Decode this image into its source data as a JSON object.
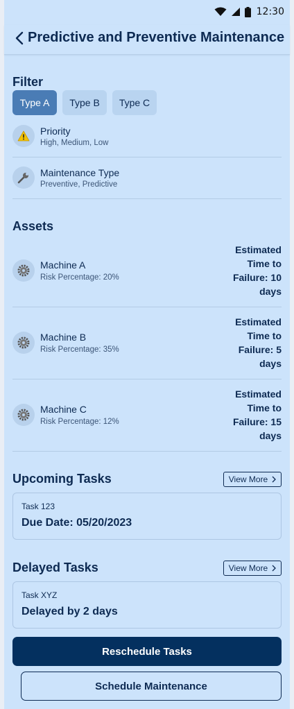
{
  "status_bar": {
    "time": "12:30",
    "icons": [
      "wifi-icon",
      "signal-icon",
      "battery-icon"
    ]
  },
  "header": {
    "title": "Predictive and Preventive Maintenance"
  },
  "filter": {
    "heading": "Filter",
    "chips": [
      {
        "label": "Type A",
        "selected": true
      },
      {
        "label": "Type B",
        "selected": false
      },
      {
        "label": "Type C",
        "selected": false
      }
    ],
    "items": [
      {
        "title": "Priority",
        "subtitle": "High, Medium, Low",
        "icon": "warning-icon"
      },
      {
        "title": "Maintenance Type",
        "subtitle": "Preventive, Predictive",
        "icon": "wrench-icon"
      }
    ]
  },
  "assets": {
    "heading": "Assets",
    "items": [
      {
        "name": "Machine A",
        "risk": "Risk Percentage: 20%",
        "estimate": [
          "Estimated",
          "Time to",
          "Failure: 10",
          "days"
        ]
      },
      {
        "name": "Machine B",
        "risk": "Risk Percentage: 35%",
        "estimate": [
          "Estimated",
          "Time to",
          "Failure: 5",
          "days"
        ]
      },
      {
        "name": "Machine C",
        "risk": "Risk Percentage: 12%",
        "estimate": [
          "Estimated",
          "Time to",
          "Failure: 15",
          "days"
        ]
      }
    ]
  },
  "upcoming": {
    "heading": "Upcoming Tasks",
    "view_more": "View More",
    "task_id": "Task 123",
    "detail": "Due Date: 05/20/2023"
  },
  "delayed": {
    "heading": "Delayed Tasks",
    "view_more": "View More",
    "task_id": "Task XYZ",
    "detail": "Delayed by 2 days"
  },
  "actions": {
    "primary": "Reschedule Tasks",
    "secondary": "Schedule Maintenance"
  },
  "colors": {
    "background": "#cce3fb",
    "primary": "#04305f",
    "chip_selected": "#4a7cb5",
    "chip": "#b9d4f0",
    "text": "#0d2a52"
  }
}
